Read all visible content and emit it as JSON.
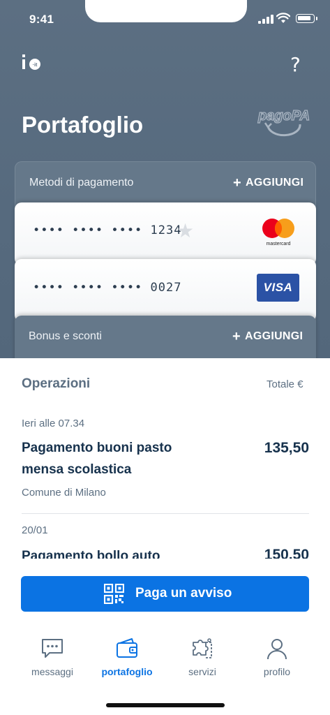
{
  "status_bar": {
    "time": "9:41"
  },
  "header": {
    "title": "Portafoglio",
    "pagopa_logo": "pagoPA"
  },
  "payment_methods": {
    "label": "Metodi di pagamento",
    "add_label": "AGGIUNGI",
    "cards": [
      {
        "number": "•••• •••• •••• 1234",
        "brand": "mastercard",
        "brand_label": "mastercard",
        "favorite_icon": "star-icon"
      },
      {
        "number": "•••• •••• •••• 0027",
        "brand": "visa",
        "brand_label": "VISA"
      }
    ]
  },
  "bonus": {
    "label": "Bonus e sconti",
    "add_label": "AGGIUNGI"
  },
  "operations": {
    "title": "Operazioni",
    "total_label": "Totale €",
    "transactions": [
      {
        "date": "Ieri alle 07.34",
        "title_line1": "Pagamento buoni pasto",
        "title_line2": "mensa scolastica",
        "amount": "135,50",
        "merchant": "Comune di Milano"
      },
      {
        "date": "20/01",
        "title_line1": "Pagamento bollo auto",
        "amount": "150,50"
      }
    ]
  },
  "pay_button": {
    "label": "Paga un avviso",
    "icon": "qr-code-icon"
  },
  "tabbar": {
    "items": [
      {
        "label": "messaggi",
        "icon": "message-icon"
      },
      {
        "label": "portafoglio",
        "icon": "wallet-icon",
        "active": true
      },
      {
        "label": "servizi",
        "icon": "puzzle-icon"
      },
      {
        "label": "profilo",
        "icon": "profile-icon"
      }
    ]
  },
  "colors": {
    "header": "#5c6f82",
    "accent": "#0b73e3",
    "text_dark": "#17324d",
    "text_muted": "#5c6f82",
    "visa": "#2b52a5",
    "mastercard_red": "#eb001b",
    "mastercard_yellow": "#f79e1b"
  }
}
